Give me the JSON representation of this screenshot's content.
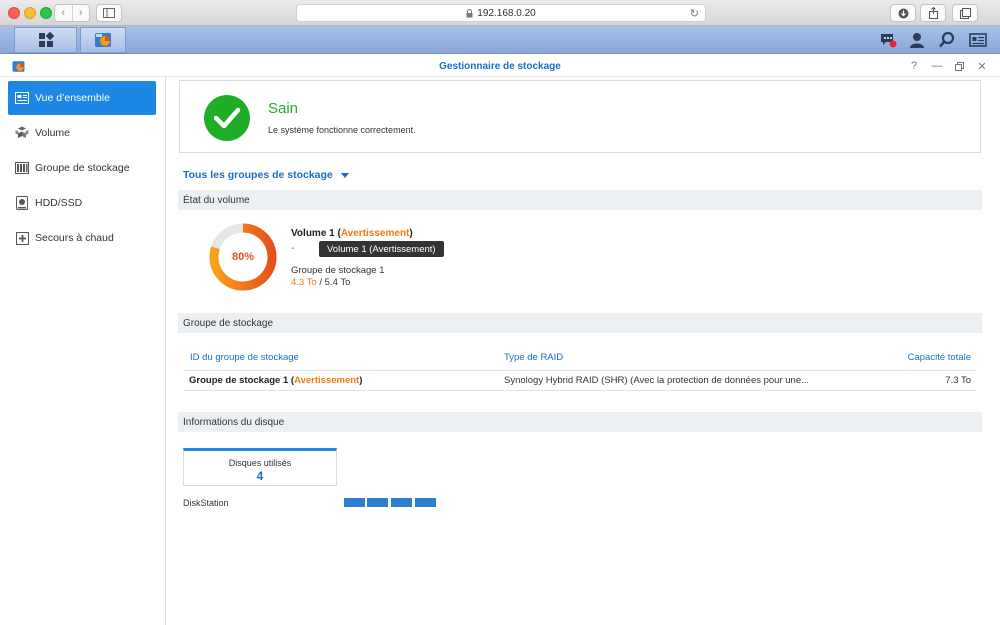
{
  "browser": {
    "url": "192.168.0.20"
  },
  "window": {
    "title": "Gestionnaire de stockage"
  },
  "nav": {
    "items": [
      {
        "label": "Vue d’ensemble",
        "icon": "overview-icon",
        "active": true
      },
      {
        "label": "Volume",
        "icon": "volume-icon",
        "active": false
      },
      {
        "label": "Groupe de stockage",
        "icon": "storage-pool-icon",
        "active": false
      },
      {
        "label": "HDD/SSD",
        "icon": "hdd-icon",
        "active": false
      },
      {
        "label": "Secours à chaud",
        "icon": "hot-spare-icon",
        "active": false
      }
    ]
  },
  "health": {
    "status": "Sain",
    "message": "Le système fonctionne correctement."
  },
  "pool_selector": {
    "label": "Tous les groupes de stockage"
  },
  "volume_section": {
    "title": "État du volume",
    "usage_percent": 80,
    "usage_label": "80%",
    "volume_name": "Volume 1",
    "status_warning": "Avertissement",
    "dash": "-",
    "tooltip": "Volume 1 (Avertissement)",
    "pool_name": "Groupe de stockage 1",
    "used": "4.3 To",
    "separator": "/",
    "total": "5.4 To"
  },
  "pool_section": {
    "title": "Groupe de stockage",
    "columns": {
      "id": "ID du groupe de stockage",
      "raid": "Type de RAID",
      "capacity": "Capacité totale"
    },
    "rows": [
      {
        "name": "Groupe de stockage 1",
        "status": "Avertissement",
        "raid": "Synology Hybrid RAID (SHR) (Avec la protection de données pour une...",
        "capacity": "7.3 To"
      }
    ]
  },
  "disk_section": {
    "title": "Informations du disque",
    "used_disks_label": "Disques utilisés",
    "used_disks_count": "4",
    "station_label": "DiskStation",
    "slot_count": 4
  },
  "colors": {
    "accent": "#1e86e4",
    "healthy": "#1fae28",
    "warning": "#f07b12",
    "donut_start": "#f7a21b",
    "donut_end": "#e8501a"
  }
}
